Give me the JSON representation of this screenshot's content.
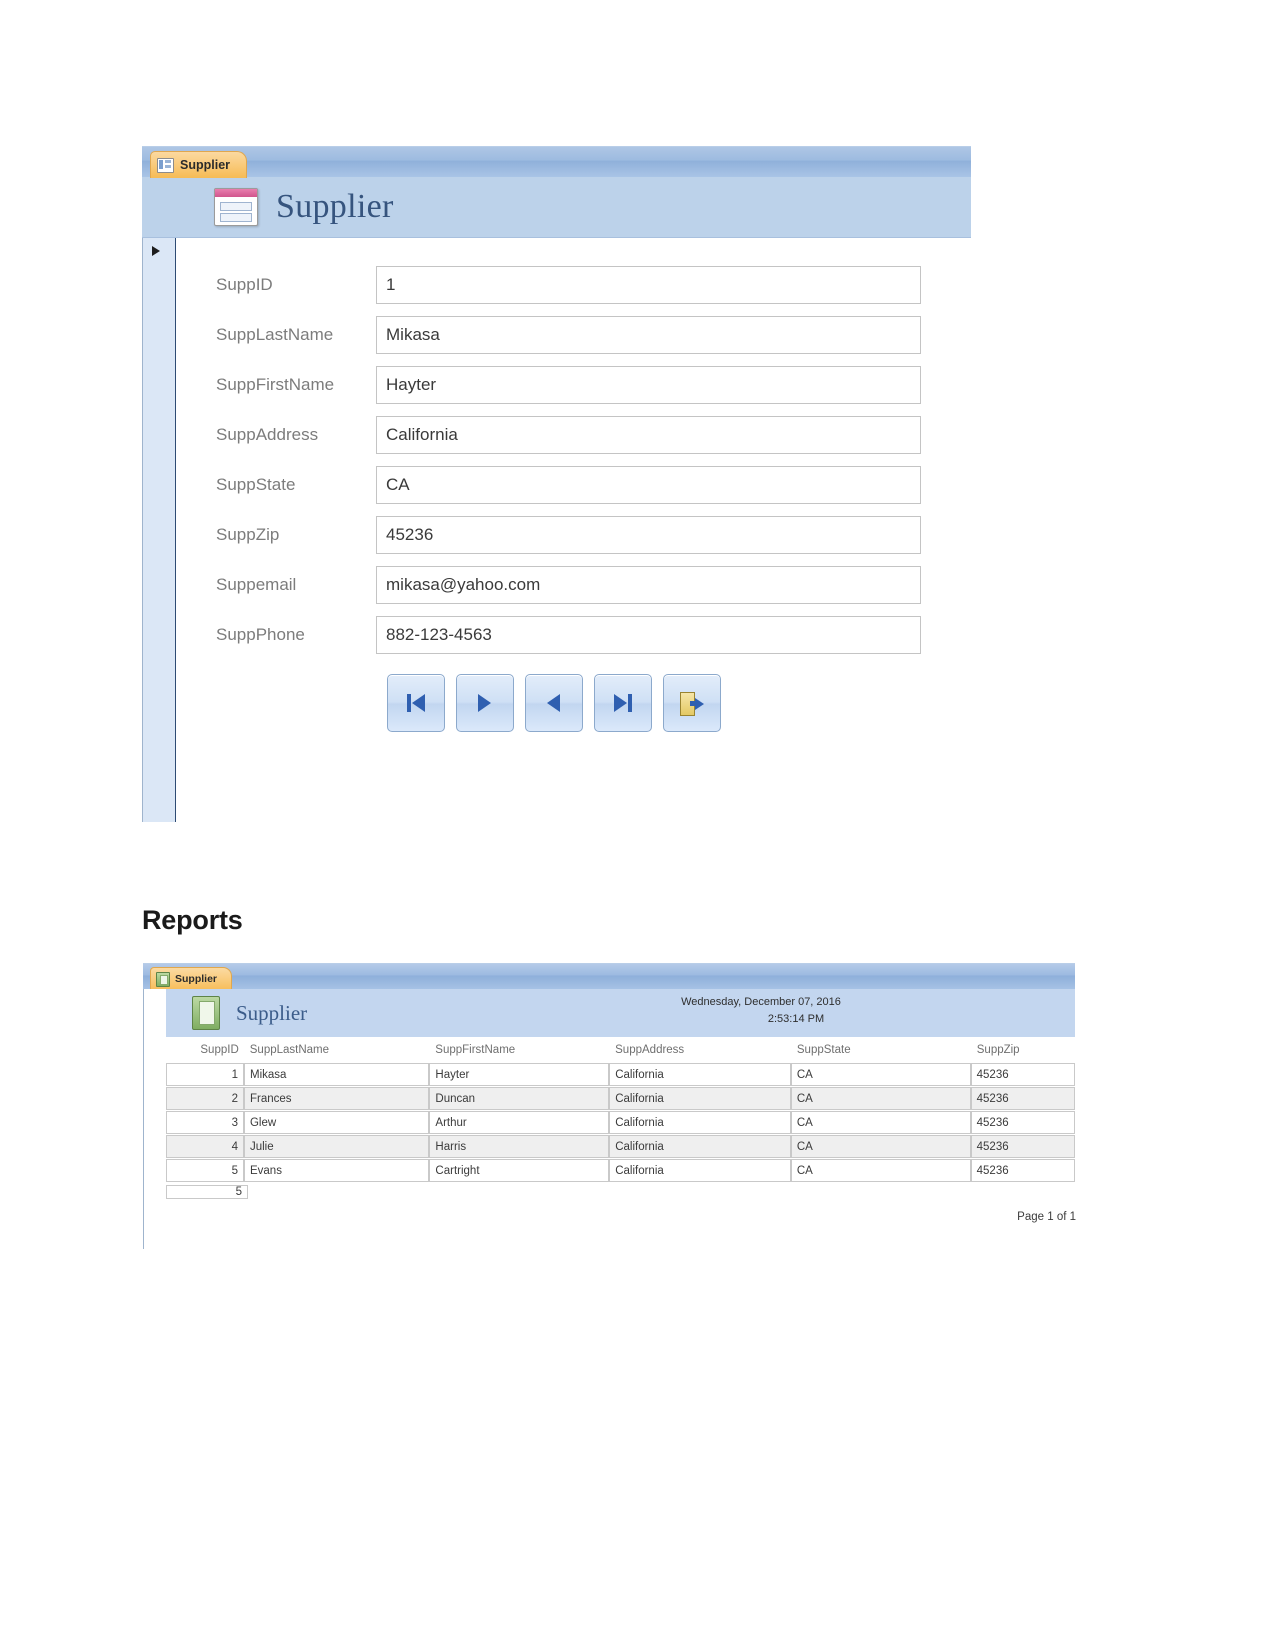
{
  "form": {
    "tab_label": "Supplier",
    "tab_icon": "form-view-icon",
    "title": "Supplier",
    "title_icon": "form-design-icon",
    "record_selector_icon": "record-selector-arrow-icon",
    "fields": [
      {
        "label": "SuppID",
        "value": "1"
      },
      {
        "label": "SuppLastName",
        "value": "Mikasa"
      },
      {
        "label": "SuppFirstName",
        "value": "Hayter"
      },
      {
        "label": "SuppAddress",
        "value": "California"
      },
      {
        "label": "SuppState",
        "value": "CA"
      },
      {
        "label": "SuppZip",
        "value": "45236"
      },
      {
        "label": "Suppemail",
        "value": "mikasa@yahoo.com"
      },
      {
        "label": "SuppPhone",
        "value": "882-123-4563"
      }
    ],
    "nav_buttons": [
      {
        "name": "first-record-button",
        "icon": "skip-to-start-icon"
      },
      {
        "name": "next-record-button",
        "icon": "play-right-icon"
      },
      {
        "name": "previous-record-button",
        "icon": "play-left-icon"
      },
      {
        "name": "last-record-button",
        "icon": "skip-to-end-icon"
      },
      {
        "name": "exit-form-button",
        "icon": "exit-door-icon"
      }
    ]
  },
  "section": {
    "reports_heading": "Reports"
  },
  "report": {
    "tab_label": "Supplier",
    "tab_icon": "report-view-icon",
    "title": "Supplier",
    "title_icon": "report-icon",
    "date": "Wednesday, December 07, 2016",
    "time": "2:53:14 PM",
    "columns": [
      "SuppID",
      "SuppLastName",
      "SuppFirstName",
      "SuppAddress",
      "SuppState",
      "SuppZip"
    ],
    "rows": [
      {
        "id": "1",
        "last": "Mikasa",
        "first": "Hayter",
        "address": "California",
        "state": "CA",
        "zip": "45236"
      },
      {
        "id": "2",
        "last": "Frances",
        "first": "Duncan",
        "address": "California",
        "state": "CA",
        "zip": "45236"
      },
      {
        "id": "3",
        "last": "Glew",
        "first": "Arthur",
        "address": "California",
        "state": "CA",
        "zip": "45236"
      },
      {
        "id": "4",
        "last": "Julie",
        "first": "Harris",
        "address": "California",
        "state": "CA",
        "zip": "45236"
      },
      {
        "id": "5",
        "last": "Evans",
        "first": "Cartright",
        "address": "California",
        "state": "CA",
        "zip": "45236"
      }
    ],
    "record_count": "5",
    "page_footer": "Page 1 of 1"
  },
  "colors": {
    "tab_orange": "#f9c977",
    "titleband_blue": "#bcd2ea",
    "title_text_blue": "#36547e",
    "report_header_blue": "#c3d6ef",
    "nav_arrow_blue": "#2f5fb0"
  }
}
